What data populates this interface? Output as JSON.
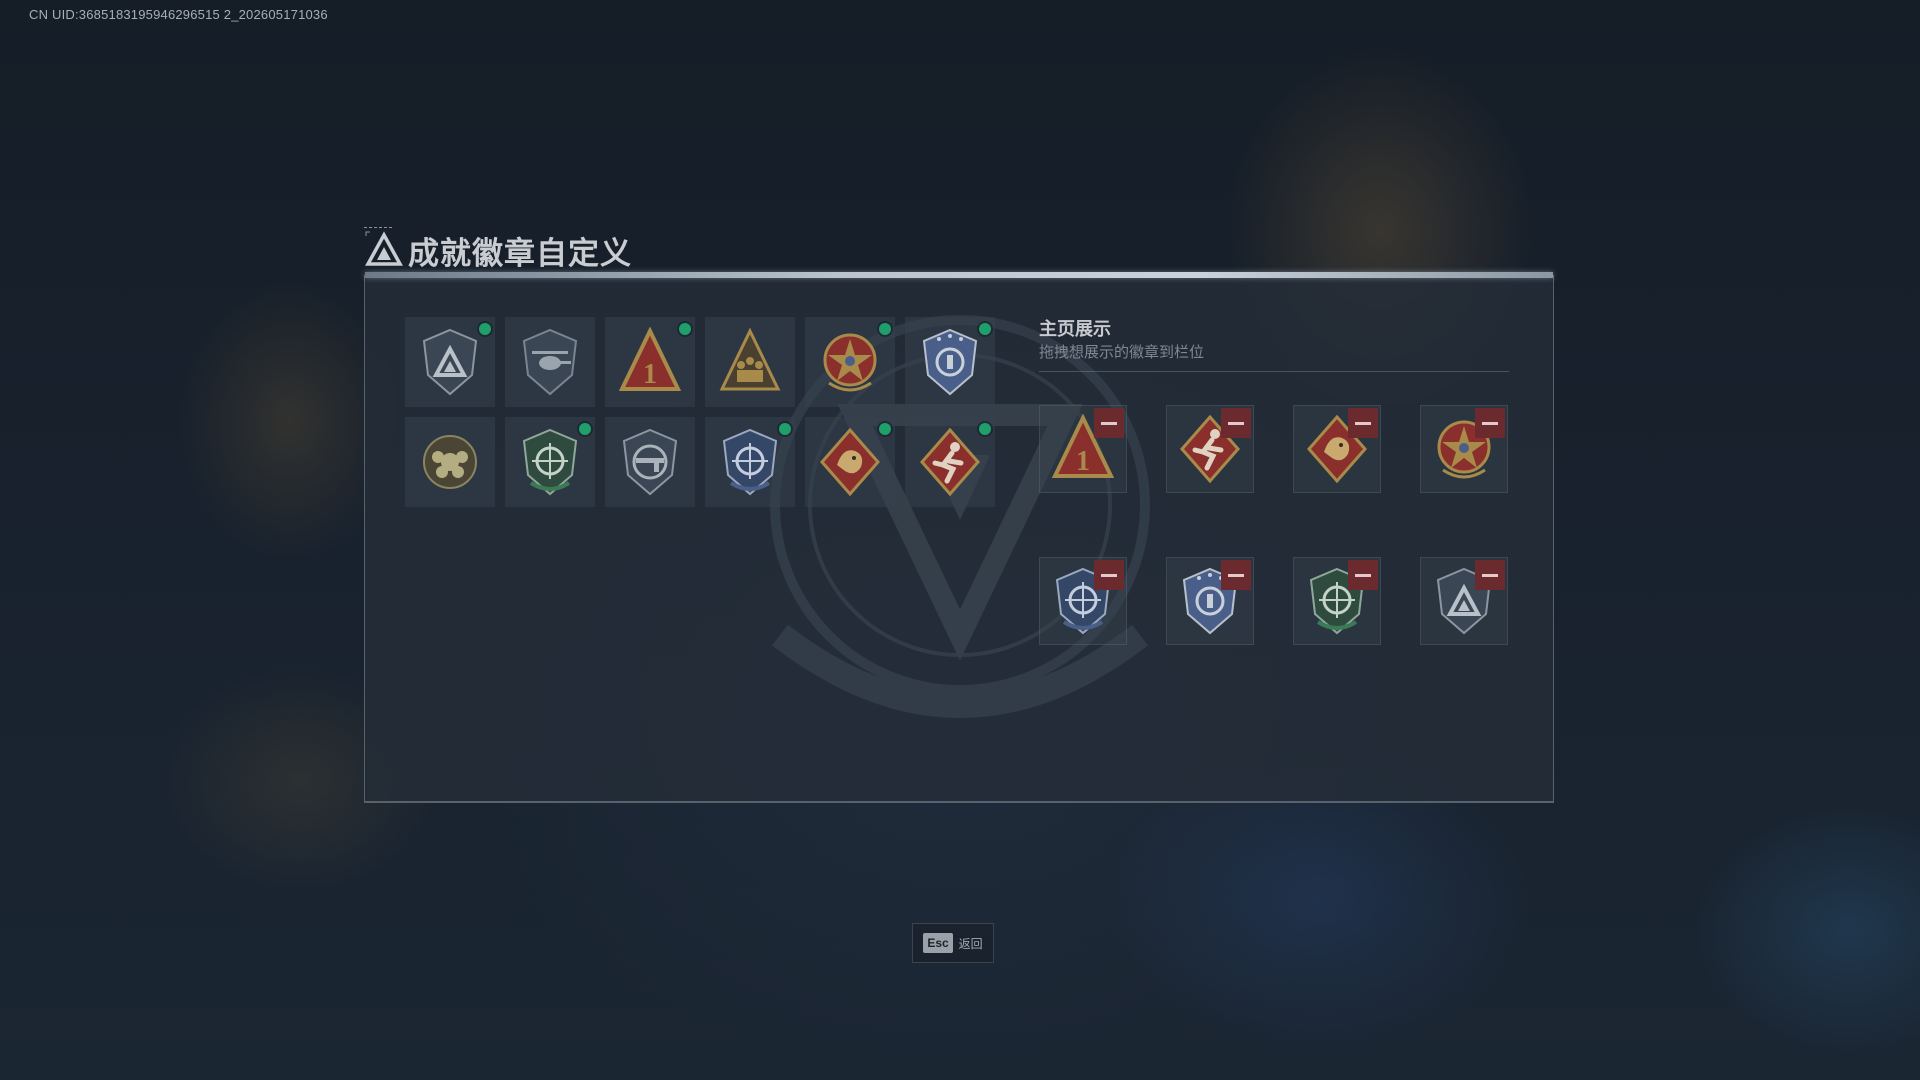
{
  "uid_text": "CN UID:3685183195946296515 2_202605171036",
  "title": "成就徽章自定义",
  "badges": [
    {
      "icon": "triangle-shield-badge-icon",
      "selected": true
    },
    {
      "icon": "helicopter-shield-badge-icon",
      "selected": false
    },
    {
      "icon": "number-one-triangle-badge-icon",
      "selected": true
    },
    {
      "icon": "soldiers-triangle-badge-icon",
      "selected": false
    },
    {
      "icon": "star-wreath-badge-icon",
      "selected": true
    },
    {
      "icon": "police-shield-badge-icon",
      "selected": true
    },
    {
      "icon": "flower-round-badge-icon",
      "selected": false
    },
    {
      "icon": "green-crosshair-shield-badge-icon",
      "selected": true
    },
    {
      "icon": "rifle-shield-badge-icon",
      "selected": false
    },
    {
      "icon": "blue-crosshair-shield-badge-icon",
      "selected": true
    },
    {
      "icon": "dragon-diamond-badge-icon",
      "selected": true
    },
    {
      "icon": "runner-diamond-badge-icon",
      "selected": true
    }
  ],
  "home_display": {
    "title": "主页展示",
    "subtitle": "拖拽想展示的徽章到栏位",
    "slots": [
      {
        "icon": "number-one-triangle-badge-icon"
      },
      {
        "icon": "runner-diamond-badge-icon"
      },
      {
        "icon": "dragon-diamond-badge-icon"
      },
      {
        "icon": "star-wreath-badge-icon"
      },
      {
        "icon": "blue-crosshair-shield-badge-icon"
      },
      {
        "icon": "police-shield-badge-icon"
      },
      {
        "icon": "green-crosshair-shield-badge-icon"
      },
      {
        "icon": "triangle-shield-badge-icon"
      }
    ]
  },
  "esc": {
    "key": "Esc",
    "label": "返回"
  },
  "colors": {
    "selected_dot": "#1fa06a",
    "remove_button": "#6b2a2e",
    "gold": "#a88a4a",
    "red": "#8a2f2c",
    "blue": "#4a5e8a",
    "green": "#3a7a55"
  }
}
